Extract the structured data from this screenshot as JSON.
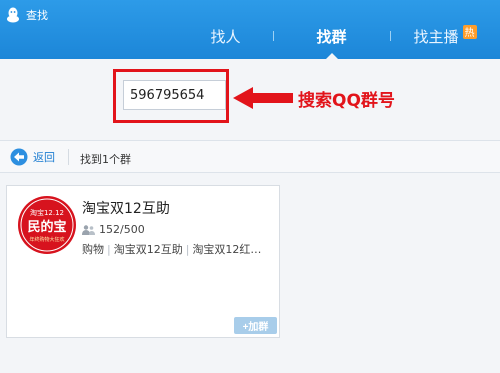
{
  "window": {
    "title": "查找",
    "accent": "#1c86d8"
  },
  "tabs": [
    {
      "label": "找人",
      "selected": false
    },
    {
      "label": "找群",
      "selected": true
    },
    {
      "label": "找主播",
      "selected": false,
      "badge": "热"
    }
  ],
  "search": {
    "value": "596795654"
  },
  "annotation": {
    "text": "搜索QQ群号",
    "color": "#e2141b"
  },
  "toolbar": {
    "back_label": "返回",
    "result_count": "找到1个群"
  },
  "result_card": {
    "name": "淘宝双12互助",
    "members": "152/500",
    "tags": [
      "购物",
      "淘宝双12互助",
      "淘宝双12红…"
    ],
    "join_label": "+加群",
    "avatar": {
      "top_text": "淘宝12.12",
      "main_text": "民的宝",
      "sub_text": "年终购物大狂欢"
    }
  }
}
